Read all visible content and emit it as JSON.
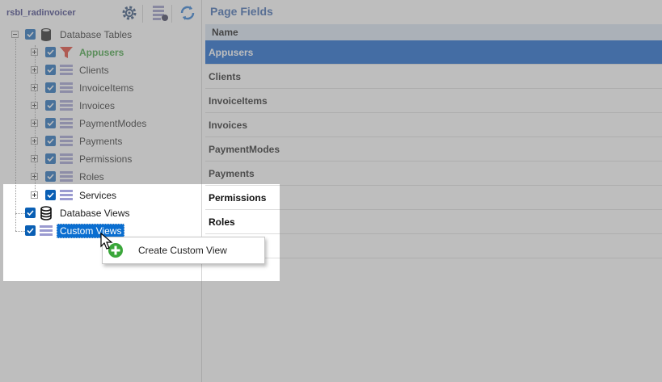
{
  "left": {
    "project_name": "rsbl_radinvoicer",
    "tree": {
      "root_label": "Database Tables",
      "tables": [
        {
          "label": "Appusers",
          "icon": "filter-icon",
          "highlight": true
        },
        {
          "label": "Clients",
          "icon": "table-icon"
        },
        {
          "label": "InvoiceItems",
          "icon": "table-icon"
        },
        {
          "label": "Invoices",
          "icon": "table-icon"
        },
        {
          "label": "PaymentModes",
          "icon": "table-icon"
        },
        {
          "label": "Payments",
          "icon": "table-icon"
        },
        {
          "label": "Permissions",
          "icon": "table-icon"
        },
        {
          "label": "Roles",
          "icon": "table-icon"
        },
        {
          "label": "Services",
          "icon": "table-icon"
        }
      ],
      "views_label": "Database Views",
      "custom_views_label": "Custom Views"
    }
  },
  "right": {
    "title": "Page Fields",
    "column_header": "Name",
    "rows": [
      "Appusers",
      "Clients",
      "InvoiceItems",
      "Invoices",
      "PaymentModes",
      "Payments",
      "Permissions",
      "Roles"
    ],
    "selected_row": "Appusers"
  },
  "context_menu": {
    "items": [
      {
        "label": "Create Custom View",
        "icon": "add-icon"
      }
    ]
  },
  "colors": {
    "selection": "#0056c8",
    "checkbox": "#0a5fb4",
    "title": "#2b5aa8",
    "highlight_text": "#2e9a2e",
    "add_icon": "#3aa63a"
  }
}
